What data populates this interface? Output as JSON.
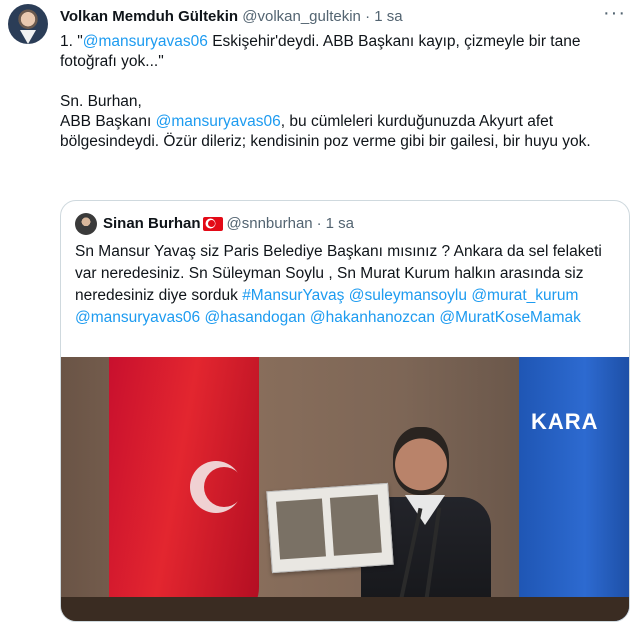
{
  "author": {
    "name": "Volkan Memduh Gültekin",
    "handle": "@volkan_gultekin",
    "separator": "·",
    "time": "1 sa"
  },
  "more_label": "···",
  "tweet": {
    "line1_prefix": "1. \"",
    "line1_mention": "@mansuryavas06",
    "line1_rest": " Eskişehir'deydi. ABB Başkanı kayıp, çizmeyle bir tane fotoğrafı yok...\"",
    "para2_line1": "Sn. Burhan,",
    "para2_prefix": "ABB Başkanı ",
    "para2_mention": "@mansuryavas06",
    "para2_rest": ", bu cümleleri kurduğunuzda Akyurt afet bölgesindeydi. Özür dileriz; kendisinin poz verme gibi bir gailesi, bir huyu yok."
  },
  "quote": {
    "name": "Sinan Burhan",
    "handle": "@snnburhan",
    "separator": "·",
    "time": "1 sa",
    "text": "Sn Mansur Yavaş siz Paris Belediye Başkanı mısınız ? Ankara da sel felaketi var neredesiniz. Sn Süleyman Soylu , Sn Murat Kurum halkın arasında siz neredesiniz diye sorduk #MansurYavaş @suleymansoylu @murat_kurum @mansuryavas06 @hasandogan @hakanhanozcan @MuratKoseMamak",
    "media_text": "KARA"
  },
  "colors": {
    "link": "#1d9bf0",
    "text": "#0f1419",
    "secondary": "#536471",
    "border": "#cfd9de"
  }
}
